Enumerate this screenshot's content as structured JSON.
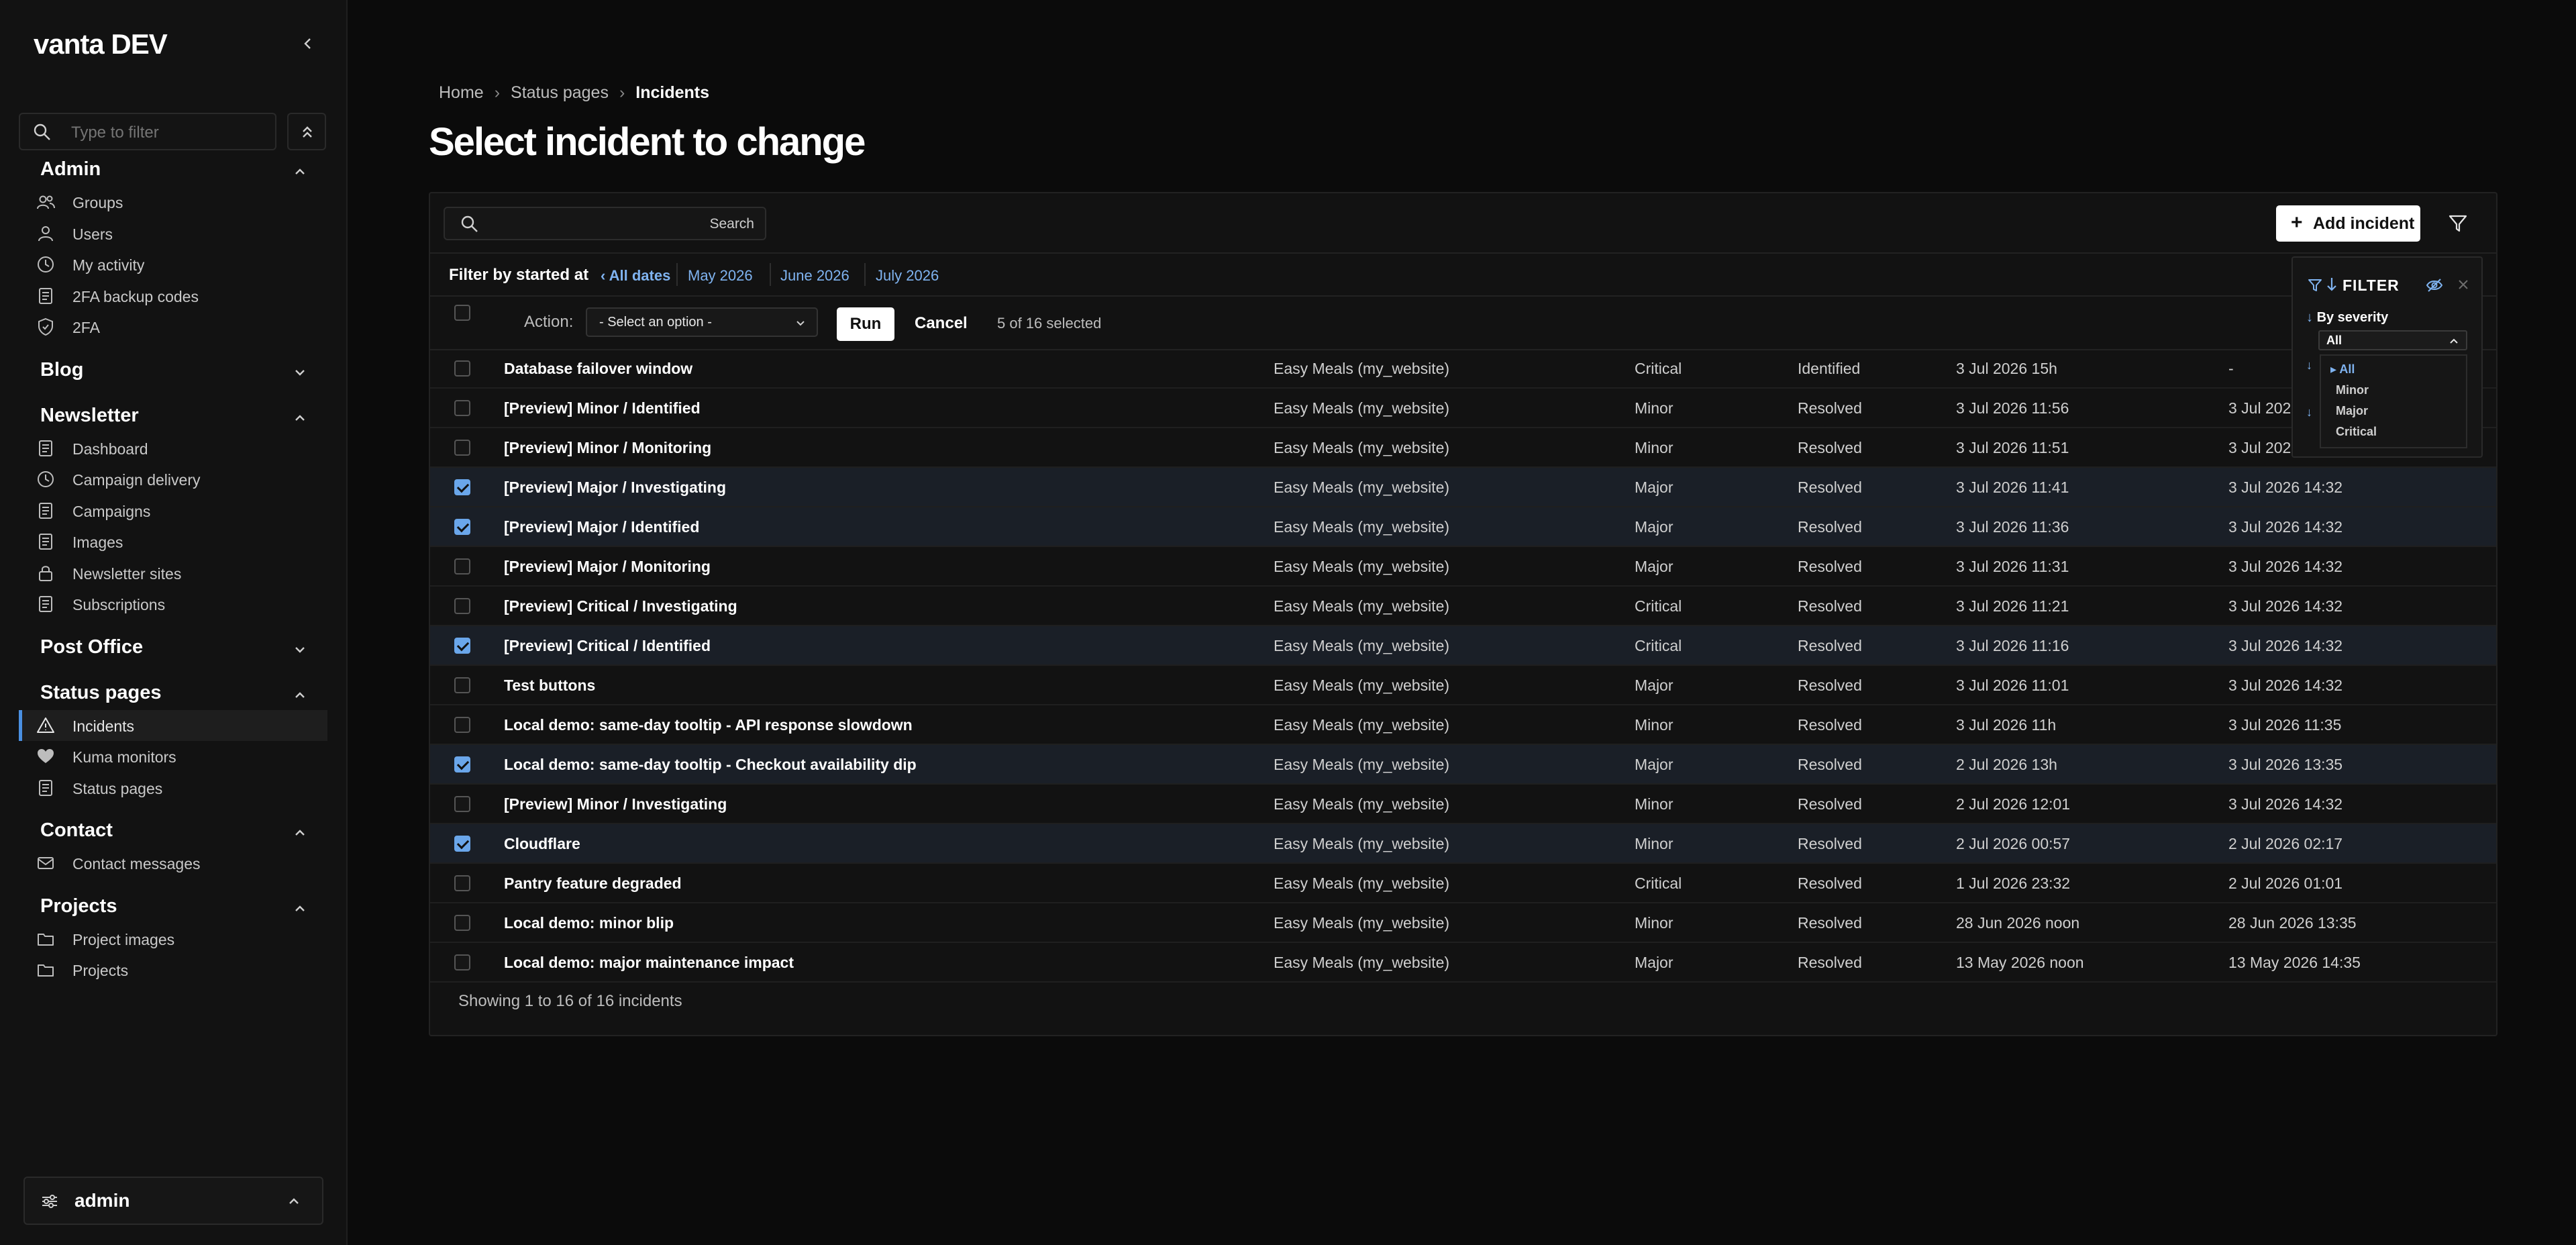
{
  "brand": "vanta DEV",
  "sidebar": {
    "filter_placeholder": "Type to filter",
    "sections": [
      {
        "title": "Admin",
        "expanded": true,
        "items": [
          {
            "label": "Groups",
            "icon": "users-group-icon"
          },
          {
            "label": "Users",
            "icon": "user-icon"
          },
          {
            "label": "My activity",
            "icon": "clock-icon"
          },
          {
            "label": "2FA backup codes",
            "icon": "document-icon"
          },
          {
            "label": "2FA",
            "icon": "shield-icon"
          }
        ]
      },
      {
        "title": "Blog",
        "expanded": false,
        "items": []
      },
      {
        "title": "Newsletter",
        "expanded": true,
        "items": [
          {
            "label": "Dashboard",
            "icon": "document-icon"
          },
          {
            "label": "Campaign delivery",
            "icon": "clock-icon"
          },
          {
            "label": "Campaigns",
            "icon": "document-icon"
          },
          {
            "label": "Images",
            "icon": "document-icon"
          },
          {
            "label": "Newsletter sites",
            "icon": "lock-icon"
          },
          {
            "label": "Subscriptions",
            "icon": "document-icon"
          }
        ]
      },
      {
        "title": "Post Office",
        "expanded": false,
        "items": []
      },
      {
        "title": "Status pages",
        "expanded": true,
        "items": [
          {
            "label": "Incidents",
            "icon": "warning-icon",
            "active": true
          },
          {
            "label": "Kuma monitors",
            "icon": "heart-icon"
          },
          {
            "label": "Status pages",
            "icon": "document-icon"
          }
        ]
      },
      {
        "title": "Contact",
        "expanded": true,
        "items": [
          {
            "label": "Contact messages",
            "icon": "mail-icon"
          }
        ]
      },
      {
        "title": "Projects",
        "expanded": true,
        "items": [
          {
            "label": "Project images",
            "icon": "folder-icon"
          },
          {
            "label": "Projects",
            "icon": "folder-icon"
          }
        ]
      }
    ],
    "user": "admin"
  },
  "breadcrumb": {
    "home": "Home",
    "parent": "Status pages",
    "current": "Incidents"
  },
  "page_title": "Select incident to change",
  "toolbar": {
    "search_button": "Search",
    "add_button": "Add incident"
  },
  "date_filter": {
    "lead": "Filter by started at",
    "all": "‹ All dates",
    "links": [
      "May 2026",
      "June 2026",
      "July 2026"
    ]
  },
  "actions": {
    "label": "Action:",
    "select_value": "- Select an option -",
    "run": "Run",
    "cancel": "Cancel",
    "selected_text": "5 of 16 selected"
  },
  "rows": [
    {
      "title": "Database failover window",
      "site": "Easy Meals (my_website)",
      "severity": "Critical",
      "status": "Identified",
      "started": "3 Jul 2026 15h",
      "ended": "-",
      "selected": false
    },
    {
      "title": "[Preview] Minor / Identified",
      "site": "Easy Meals (my_website)",
      "severity": "Minor",
      "status": "Resolved",
      "started": "3 Jul 2026 11:56",
      "ended": "3 Jul 2026 14:32",
      "selected": false
    },
    {
      "title": "[Preview] Minor / Monitoring",
      "site": "Easy Meals (my_website)",
      "severity": "Minor",
      "status": "Resolved",
      "started": "3 Jul 2026 11:51",
      "ended": "3 Jul 2026 14:32",
      "selected": false
    },
    {
      "title": "[Preview] Major / Investigating",
      "site": "Easy Meals (my_website)",
      "severity": "Major",
      "status": "Resolved",
      "started": "3 Jul 2026 11:41",
      "ended": "3 Jul 2026 14:32",
      "selected": true
    },
    {
      "title": "[Preview] Major / Identified",
      "site": "Easy Meals (my_website)",
      "severity": "Major",
      "status": "Resolved",
      "started": "3 Jul 2026 11:36",
      "ended": "3 Jul 2026 14:32",
      "selected": true
    },
    {
      "title": "[Preview] Major / Monitoring",
      "site": "Easy Meals (my_website)",
      "severity": "Major",
      "status": "Resolved",
      "started": "3 Jul 2026 11:31",
      "ended": "3 Jul 2026 14:32",
      "selected": false
    },
    {
      "title": "[Preview] Critical / Investigating",
      "site": "Easy Meals (my_website)",
      "severity": "Critical",
      "status": "Resolved",
      "started": "3 Jul 2026 11:21",
      "ended": "3 Jul 2026 14:32",
      "selected": false
    },
    {
      "title": "[Preview] Critical / Identified",
      "site": "Easy Meals (my_website)",
      "severity": "Critical",
      "status": "Resolved",
      "started": "3 Jul 2026 11:16",
      "ended": "3 Jul 2026 14:32",
      "selected": true
    },
    {
      "title": "Test buttons",
      "site": "Easy Meals (my_website)",
      "severity": "Major",
      "status": "Resolved",
      "started": "3 Jul 2026 11:01",
      "ended": "3 Jul 2026 14:32",
      "selected": false
    },
    {
      "title": "Local demo: same-day tooltip - API response slowdown",
      "site": "Easy Meals (my_website)",
      "severity": "Minor",
      "status": "Resolved",
      "started": "3 Jul 2026 11h",
      "ended": "3 Jul 2026 11:35",
      "selected": false
    },
    {
      "title": "Local demo: same-day tooltip - Checkout availability dip",
      "site": "Easy Meals (my_website)",
      "severity": "Major",
      "status": "Resolved",
      "started": "2 Jul 2026 13h",
      "ended": "3 Jul 2026 13:35",
      "selected": true
    },
    {
      "title": "[Preview] Minor / Investigating",
      "site": "Easy Meals (my_website)",
      "severity": "Minor",
      "status": "Resolved",
      "started": "2 Jul 2026 12:01",
      "ended": "3 Jul 2026 14:32",
      "selected": false
    },
    {
      "title": "Cloudflare",
      "site": "Easy Meals (my_website)",
      "severity": "Minor",
      "status": "Resolved",
      "started": "2 Jul 2026 00:57",
      "ended": "2 Jul 2026 02:17",
      "selected": true
    },
    {
      "title": "Pantry feature degraded",
      "site": "Easy Meals (my_website)",
      "severity": "Critical",
      "status": "Resolved",
      "started": "1 Jul 2026 23:32",
      "ended": "2 Jul 2026 01:01",
      "selected": false
    },
    {
      "title": "Local demo: minor blip",
      "site": "Easy Meals (my_website)",
      "severity": "Minor",
      "status": "Resolved",
      "started": "28 Jun 2026 noon",
      "ended": "28 Jun 2026 13:35",
      "selected": false
    },
    {
      "title": "Local demo: major maintenance impact",
      "site": "Easy Meals (my_website)",
      "severity": "Major",
      "status": "Resolved",
      "started": "13 May 2026 noon",
      "ended": "13 May 2026 14:35",
      "selected": false
    }
  ],
  "footer": "Showing 1 to 16 of 16 incidents",
  "filter_panel": {
    "title": "FILTER",
    "by": "By severity",
    "selected": "All",
    "options": [
      "All",
      "Minor",
      "Major",
      "Critical"
    ]
  },
  "colors": {
    "accent": "#6aa6ea",
    "link": "#7fb3f0",
    "background": "#0b0b0b"
  }
}
